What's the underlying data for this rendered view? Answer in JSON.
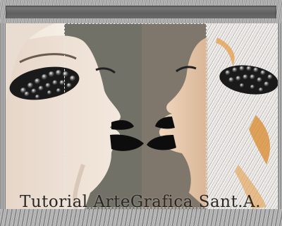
{
  "caption": "Tutorial ArteGrafica Sant.A."
}
